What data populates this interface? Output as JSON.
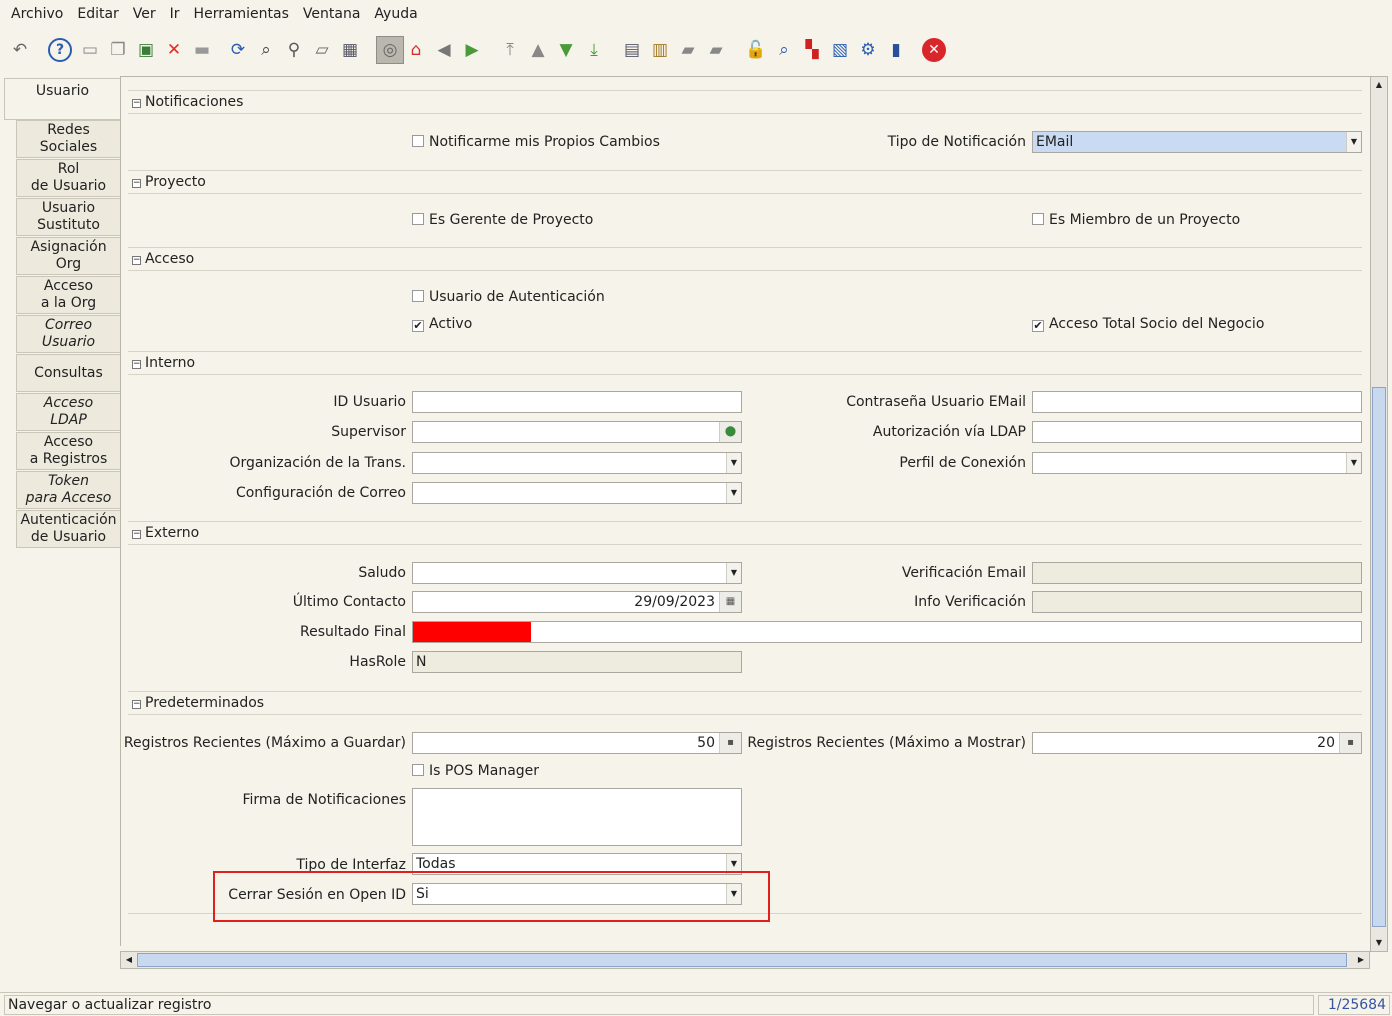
{
  "menu": [
    "Archivo",
    "Editar",
    "Ver",
    "Ir",
    "Herramientas",
    "Ventana",
    "Ayuda"
  ],
  "toolbar": [
    {
      "name": "undo-icon",
      "g": "↶",
      "c": "#666"
    },
    {
      "name": "help-icon",
      "g": "?",
      "c": "#2a5db0"
    },
    {
      "name": "new-record-icon",
      "g": "▭",
      "c": "#888"
    },
    {
      "name": "copy-record-icon",
      "g": "❐",
      "c": "#888"
    },
    {
      "name": "save-icon",
      "g": "▣",
      "c": "#3a7d3a"
    },
    {
      "name": "delete-icon",
      "g": "✕",
      "c": "#e03020"
    },
    {
      "name": "save-disabled-icon",
      "g": "▬",
      "c": "#999"
    },
    {
      "name": "refresh-icon",
      "g": "⟳",
      "c": "#2a5db0"
    },
    {
      "name": "find-icon",
      "g": "⌕",
      "c": "#444"
    },
    {
      "name": "attachment-icon",
      "g": "⚲",
      "c": "#555"
    },
    {
      "name": "chat-icon",
      "g": "▱",
      "c": "#666"
    },
    {
      "name": "grid-toggle-icon",
      "g": "▦",
      "c": "#556"
    },
    {
      "name": "history-icon",
      "g": "◎",
      "c": "#666"
    },
    {
      "name": "home-icon",
      "g": "⌂",
      "c": "#d03030"
    },
    {
      "name": "parent-record-icon",
      "g": "◀",
      "c": "#777"
    },
    {
      "name": "detail-record-icon",
      "g": "▶",
      "c": "#4a9a3a"
    },
    {
      "name": "first-record-icon",
      "g": "⤒",
      "c": "#888"
    },
    {
      "name": "previous-record-icon",
      "g": "▲",
      "c": "#888"
    },
    {
      "name": "next-record-icon",
      "g": "▼",
      "c": "#4a9a3a"
    },
    {
      "name": "last-record-icon",
      "g": "⤓",
      "c": "#4a9a3a"
    },
    {
      "name": "report-icon",
      "g": "▤",
      "c": "#556"
    },
    {
      "name": "archive-icon",
      "g": "▥",
      "c": "#a07820"
    },
    {
      "name": "print-preview-icon",
      "g": "▰",
      "c": "#888"
    },
    {
      "name": "print-icon",
      "g": "▰",
      "c": "#888"
    },
    {
      "name": "lock-icon",
      "g": "🔓",
      "c": "#d0a000"
    },
    {
      "name": "zoom-across-icon",
      "g": "⌕",
      "c": "#2a5db0"
    },
    {
      "name": "request-icon",
      "g": "▚",
      "c": "#d02020"
    },
    {
      "name": "product-info-icon",
      "g": "▧",
      "c": "#2a5db0"
    },
    {
      "name": "workflow-icon",
      "g": "⚙",
      "c": "#2a5db0"
    },
    {
      "name": "customize-icon",
      "g": "▮",
      "c": "#2a4f9a"
    },
    {
      "name": "exit-icon",
      "g": "✕",
      "c": "#fff"
    }
  ],
  "tabs": [
    {
      "l1": "Usuario",
      "l2": ""
    },
    {
      "l1": "Redes",
      "l2": "Sociales"
    },
    {
      "l1": "Rol",
      "l2": "de Usuario"
    },
    {
      "l1": "Usuario",
      "l2": "Sustituto"
    },
    {
      "l1": "Asignación",
      "l2": "Org"
    },
    {
      "l1": "Acceso",
      "l2": "a la Org"
    },
    {
      "l1": "Correo",
      "l2": "Usuario"
    },
    {
      "l1": "Consultas",
      "l2": ""
    },
    {
      "l1": "Acceso",
      "l2": "LDAP"
    },
    {
      "l1": "Acceso",
      "l2": "a Registros"
    },
    {
      "l1": "Token",
      "l2": "para Acceso"
    },
    {
      "l1": "Autenticación",
      "l2": "de Usuario"
    }
  ],
  "sections": {
    "notificaciones": "Notificaciones",
    "proyecto": "Proyecto",
    "acceso": "Acceso",
    "interno": "Interno",
    "externo": "Externo",
    "predeterminados": "Predeterminados"
  },
  "fields": {
    "notify_own": "Notificarme mis Propios Cambios",
    "tipo_notif_label": "Tipo de Notificación",
    "tipo_notif_value": "EMail",
    "es_gerente": "Es Gerente de Proyecto",
    "es_miembro": "Es Miembro de un Proyecto",
    "usuario_auth": "Usuario de Autenticación",
    "activo": "Activo",
    "acceso_total": "Acceso Total Socio del Negocio",
    "id_usuario": "ID Usuario",
    "contrasena": "Contraseña Usuario EMail",
    "supervisor": "Supervisor",
    "autorizacion_ldap": "Autorización vía LDAP",
    "org_trans": "Organización de la Trans.",
    "perfil_conexion": "Perfil de Conexión",
    "config_correo": "Configuración de Correo",
    "saludo": "Saludo",
    "verif_email": "Verificación Email",
    "ultimo_contacto": "Último Contacto",
    "ultimo_contacto_value": "29/09/2023",
    "info_verif": "Info Verificación",
    "resultado_final": "Resultado Final",
    "hasrole": "HasRole",
    "hasrole_value": "N",
    "reg_guardar": "Registros Recientes (Máximo a Guardar)",
    "reg_guardar_value": "50",
    "reg_mostrar": "Registros Recientes (Máximo a Mostrar)",
    "reg_mostrar_value": "20",
    "pos_manager": "Is POS Manager",
    "firma": "Firma de Notificaciones",
    "tipo_interfaz": "Tipo de Interfaz",
    "tipo_interfaz_value": "Todas",
    "cerrar_sesion": "Cerrar Sesión en Open ID",
    "cerrar_sesion_value": "Si"
  },
  "checked": {
    "notify_own": false,
    "es_gerente": false,
    "es_miembro": false,
    "usuario_auth": false,
    "activo": true,
    "acceso_total": true,
    "pos_manager": false
  },
  "status": {
    "message": "Navegar o actualizar registro",
    "count": "1/25684"
  },
  "colors": {
    "highlight_box": "#e0201c",
    "resultado_final_fill": "#ff0000"
  }
}
